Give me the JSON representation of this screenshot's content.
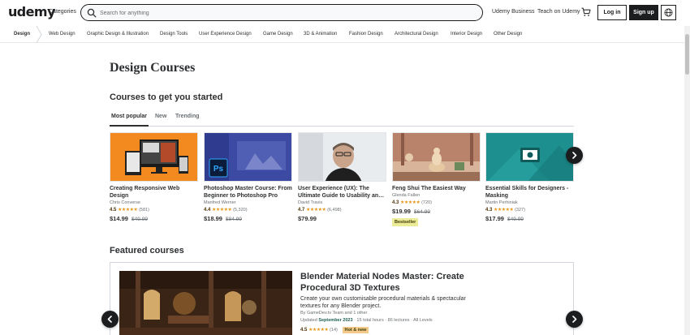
{
  "header": {
    "logo": "udemy",
    "categories": "Categories",
    "search_placeholder": "Search for anything",
    "udemy_business": "Udemy Business",
    "teach": "Teach on Udemy",
    "login": "Log in",
    "signup": "Sign up"
  },
  "subnav": {
    "items": [
      "Design",
      "Web Design",
      "Graphic Design & Illustration",
      "Design Tools",
      "User Experience Design",
      "Game Design",
      "3D & Animation",
      "Fashion Design",
      "Architectural Design",
      "Interior Design",
      "Other Design"
    ]
  },
  "page": {
    "title": "Design Courses",
    "section_title": "Courses to get you started",
    "tabs": [
      "Most popular",
      "New",
      "Trending"
    ],
    "featured_title": "Featured courses"
  },
  "courses": [
    {
      "title": "Creating Responsive Web Design",
      "author": "Chris Converse",
      "rating": "4.5",
      "stars": "★★★★★",
      "count": "(581)",
      "price": "$14.99",
      "old_price": "$49.99",
      "badge": ""
    },
    {
      "title": "Photoshop Master Course: From Beginner to Photoshop Pro",
      "author": "Manfred Werner",
      "rating": "4.4",
      "stars": "★★★★★",
      "count": "(5,320)",
      "price": "$18.99",
      "old_price": "$84.99",
      "badge": ""
    },
    {
      "title": "User Experience (UX): The Ultimate Guide to Usability an…",
      "author": "David Travis",
      "rating": "4.7",
      "stars": "★★★★★",
      "count": "(6,498)",
      "price": "$79.99",
      "old_price": "",
      "badge": ""
    },
    {
      "title": "Feng Shui The Easiest Way",
      "author": "Glenda Fallen",
      "rating": "4.3",
      "stars": "★★★★★",
      "count": "(720)",
      "price": "$19.99",
      "old_price": "$64.99",
      "badge": "Bestseller"
    },
    {
      "title": "Essential Skills for Designers - Masking",
      "author": "Martin Perhiniak",
      "rating": "4.3",
      "stars": "★★★★★",
      "count": "(327)",
      "price": "$17.99",
      "old_price": "$49.99",
      "badge": ""
    }
  ],
  "featured": {
    "title": "Blender Material Nodes Master: Create Procedural 3D Textures",
    "description": "Create your own customisable procedural materials & spectacular textures for any Blender project.",
    "by": "By GameDev.tv Team and 1 other",
    "updated_label": "Updated",
    "updated_date": "September 2023",
    "meta": " · 15 total hours · 86 lectures · All Levels",
    "rating": "4.5",
    "stars": "★★★★★",
    "count": "(14)",
    "badge": "Hot & new"
  },
  "colors": {
    "accent": "#a435f0",
    "dark": "#1c1d1f",
    "star": "#e59819",
    "bestseller_bg": "#eceb98",
    "hotnew_bg": "#f3ca8c"
  },
  "icons": [
    "search-icon",
    "cart-icon",
    "globe-icon",
    "chevron-right-icon",
    "chevron-left-icon"
  ]
}
